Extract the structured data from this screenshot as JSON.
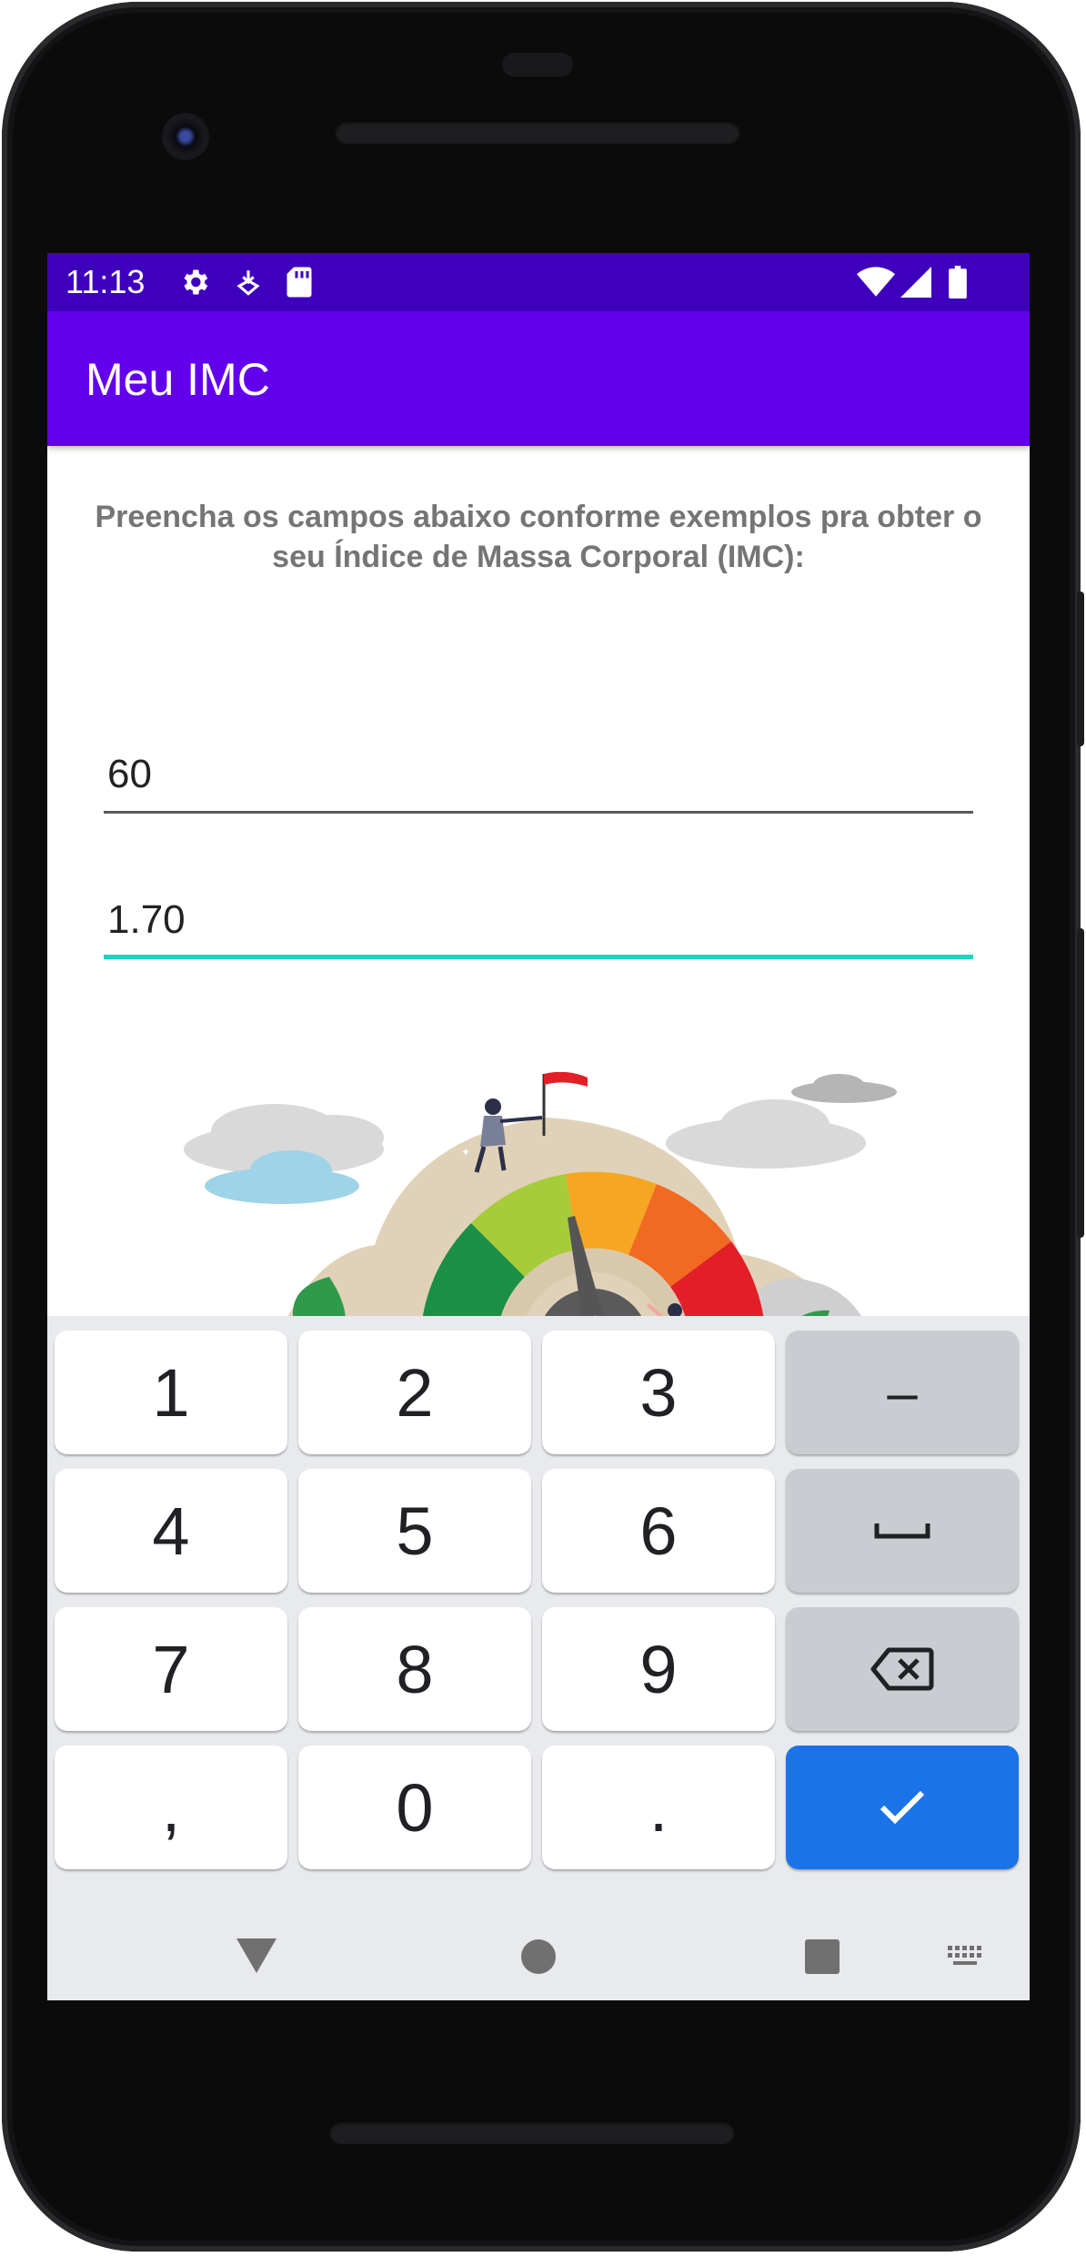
{
  "status_bar": {
    "time": "11:13",
    "icons_left": [
      "settings-icon",
      "download-icon",
      "sd-card-icon"
    ],
    "icons_right": [
      "wifi-icon",
      "signal-icon",
      "battery-icon"
    ]
  },
  "app_bar": {
    "title": "Meu IMC"
  },
  "instructions": "Preencha os campos abaixo conforme exemplos pra obter o seu Índice de Massa Corporal (IMC):",
  "form": {
    "weight_value": "60",
    "height_value": "1.70",
    "focused_field": "height"
  },
  "keyboard": {
    "keys": [
      [
        "1",
        "2",
        "3",
        "–"
      ],
      [
        "4",
        "5",
        "6",
        "␣"
      ],
      [
        "7",
        "8",
        "9",
        "⌫"
      ],
      [
        ",",
        "0",
        ".",
        "✓"
      ]
    ],
    "row1": {
      "k1": "1",
      "k2": "2",
      "k3": "3",
      "k4": "–"
    },
    "row2": {
      "k1": "4",
      "k2": "5",
      "k3": "6"
    },
    "row3": {
      "k1": "7",
      "k2": "8",
      "k3": "9"
    },
    "row4": {
      "k1": ",",
      "k2": "0",
      "k3": "."
    }
  },
  "navbar": {
    "icons": [
      "back-icon",
      "home-icon",
      "recents-icon",
      "keyboard-switch-icon"
    ]
  },
  "colors": {
    "status_bar": "#3f00bd",
    "app_bar": "#6200ee",
    "focus_accent": "#1fd3c0",
    "done_key": "#1a73e8"
  }
}
